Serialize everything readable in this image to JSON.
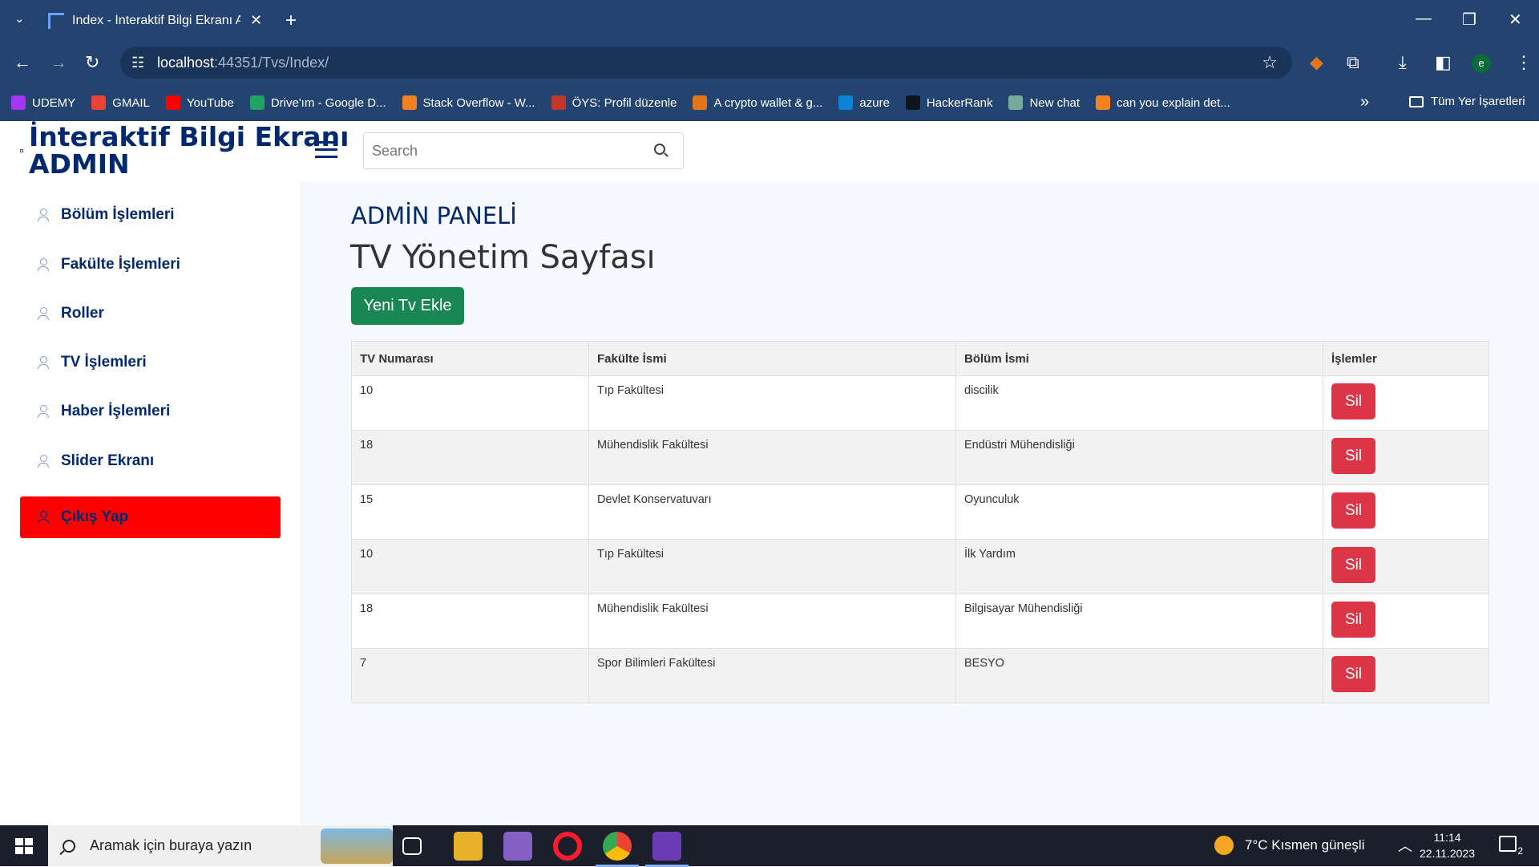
{
  "browser": {
    "tab_title": "Index - İnteraktif Bilgi Ekranı Ad",
    "url_host": "localhost",
    "url_rest": ":44351/Tvs/Index/",
    "bookmarks": [
      {
        "label": "UDEMY",
        "color": "#a435f0"
      },
      {
        "label": "GMAIL",
        "color": "#ea4335"
      },
      {
        "label": "YouTube",
        "color": "#ff0000"
      },
      {
        "label": "Drive'ım - Google D...",
        "color": "#1fa463"
      },
      {
        "label": "Stack Overflow - W...",
        "color": "#f48024"
      },
      {
        "label": "ÖYS: Profil düzenle",
        "color": "#c0392b"
      },
      {
        "label": "A crypto wallet & g...",
        "color": "#e2761b"
      },
      {
        "label": "azure",
        "color": "#0a84d6"
      },
      {
        "label": "HackerRank",
        "color": "#0e141e"
      },
      {
        "label": "New chat",
        "color": "#74aa9c"
      },
      {
        "label": "can you explain det...",
        "color": "#f58220"
      }
    ],
    "all_bookmarks_label": "Tüm Yer İşaretleri",
    "profile_initial": "e"
  },
  "header": {
    "brand_line1": "İnteraktif Bilgi Ekranı",
    "brand_line2": "ADMIN",
    "search_placeholder": "Search"
  },
  "sidebar": {
    "items": [
      {
        "label": "Bölüm İşlemleri"
      },
      {
        "label": "Fakülte İşlemleri"
      },
      {
        "label": "Roller"
      },
      {
        "label": "TV İşlemleri"
      },
      {
        "label": "Haber İşlemleri"
      },
      {
        "label": "Slider Ekranı"
      },
      {
        "label": "Çıkış Yap"
      }
    ]
  },
  "main": {
    "panel_title": "ADMİN PANELİ",
    "page_title": "TV Yönetim Sayfası",
    "add_button": "Yeni Tv Ekle",
    "table": {
      "headers": [
        "TV Numarası",
        "Fakülte İsmi",
        "Bölüm İsmi",
        "İşlemler"
      ],
      "delete_label": "Sil",
      "rows": [
        [
          "10",
          "Tıp Fakültesi",
          "discilik"
        ],
        [
          "18",
          "Mühendislik Fakültesi",
          "Endüstri Mühendisliği"
        ],
        [
          "15",
          "Devlet Konservatuvarı",
          "Oyunculuk"
        ],
        [
          "10",
          "Tıp Fakültesi",
          "İlk Yardım"
        ],
        [
          "18",
          "Mühendislik Fakültesi",
          "Bilgisayar Mühendisliği"
        ],
        [
          "7",
          "Spor Bilimleri Fakültesi",
          "BESYO"
        ]
      ]
    }
  },
  "taskbar": {
    "search_text": "Aramak için buraya yazın",
    "weather": "7°C  Kısmen güneşli",
    "time": "11:14",
    "date": "22.11.2023",
    "notification_count": "2"
  }
}
